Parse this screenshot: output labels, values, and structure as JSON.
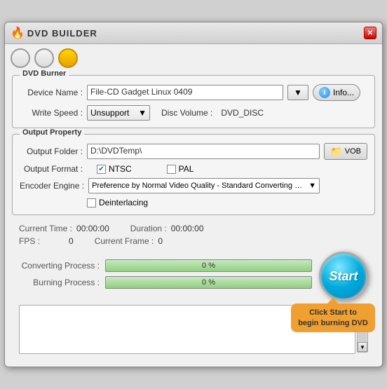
{
  "window": {
    "title": "DVD BUILDER",
    "close_label": "✕"
  },
  "controls": {
    "btn1_label": "",
    "btn2_label": "",
    "btn3_label": ""
  },
  "dvd_burner": {
    "group_label": "DVD Burner",
    "device_name_label": "Device Name :",
    "device_value": "File-CD Gadget  Linux   0409",
    "info_label": "Info...",
    "write_speed_label": "Write Speed :",
    "write_speed_value": "Unsupport",
    "disc_volume_label": "Disc Volume :",
    "disc_volume_value": "DVD_DISC"
  },
  "output_property": {
    "group_label": "Output Property",
    "output_folder_label": "Output Folder :",
    "output_folder_value": "D:\\DVDTemp\\",
    "vob_label": "VOB",
    "output_format_label": "Output Format :",
    "ntsc_label": "NTSC",
    "pal_label": "PAL",
    "encoder_label": "Encoder Engine :",
    "encoder_value": "Preference by Normal Video Quality - Standard Converting speed",
    "deinterlacing_label": "Deinterlacing"
  },
  "stats": {
    "current_time_label": "Current Time :",
    "current_time_value": "00:00:00",
    "duration_label": "Duration :",
    "duration_value": "00:00:00",
    "fps_label": "FPS :",
    "fps_value": "0",
    "current_frame_label": "Current Frame :",
    "current_frame_value": "0"
  },
  "progress": {
    "converting_label": "Converting Process :",
    "converting_value": "0 %",
    "burning_label": "Burning Process :",
    "burning_value": "0 %"
  },
  "start_button": {
    "label": "Start"
  },
  "tooltip": {
    "text": "Click Start to begin burning DVD"
  }
}
